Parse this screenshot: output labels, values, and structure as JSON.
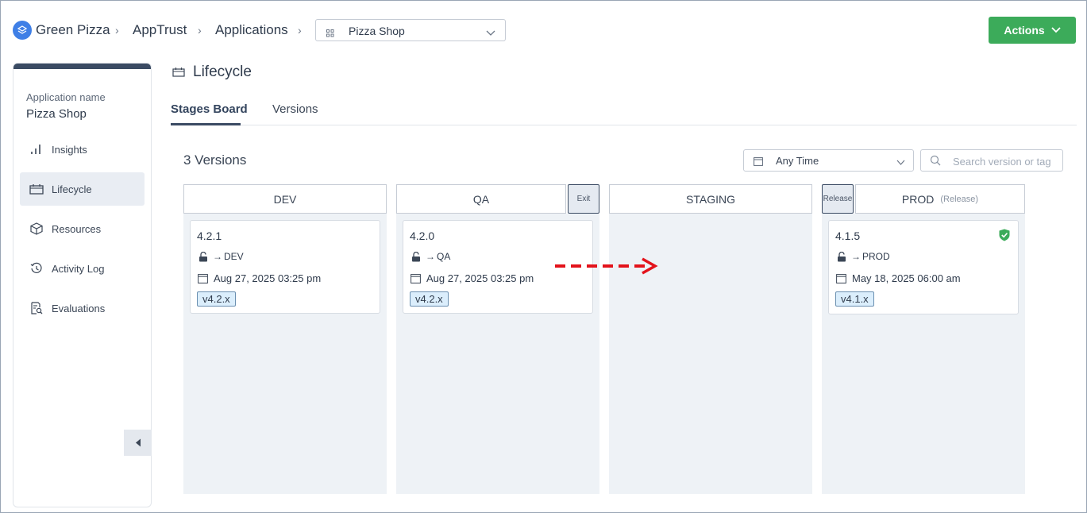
{
  "breadcrumb": {
    "org": "Green Pizza",
    "product": "AppTrust",
    "section": "Applications",
    "app_select": "Pizza Shop"
  },
  "header": {
    "actions_label": "Actions"
  },
  "sidebar": {
    "app_label": "Application name",
    "app_name": "Pizza Shop",
    "items": [
      {
        "label": "Insights",
        "icon": "bar-chart-icon"
      },
      {
        "label": "Lifecycle",
        "icon": "lifecycle-icon",
        "active": true
      },
      {
        "label": "Resources",
        "icon": "package-icon"
      },
      {
        "label": "Activity Log",
        "icon": "history-icon"
      },
      {
        "label": "Evaluations",
        "icon": "evaluation-icon"
      }
    ]
  },
  "page": {
    "title": "Lifecycle",
    "tabs": [
      {
        "label": "Stages Board",
        "active": true
      },
      {
        "label": "Versions"
      }
    ]
  },
  "board": {
    "versions_count": "3 Versions",
    "time_filter": "Any Time",
    "search_placeholder": "Search version or tag",
    "gates": {
      "exit": "Exit",
      "release": "Release"
    },
    "columns": [
      {
        "name": "DEV",
        "sub": ""
      },
      {
        "name": "QA",
        "sub": ""
      },
      {
        "name": "STAGING",
        "sub": ""
      },
      {
        "name": "PROD",
        "sub": "(Release)"
      }
    ],
    "cards": [
      {
        "version": "4.2.1",
        "stage": "DEV",
        "date": "Aug 27, 2025 03:25 pm",
        "tag": "v4.2.x"
      },
      {
        "version": "4.2.0",
        "stage": "QA",
        "date": "Aug 27, 2025 03:25 pm",
        "tag": "v4.2.x"
      },
      {
        "version": "4.1.5",
        "stage": "PROD",
        "date": "May 18, 2025 06:00 am",
        "tag": "v4.1.x"
      }
    ]
  },
  "colors": {
    "accent_green": "#3cab5a",
    "navy": "#3b4b63",
    "column_bg": "#eef2f6",
    "tag_bg": "#dbeefc",
    "annotation_red": "#e3131b"
  }
}
